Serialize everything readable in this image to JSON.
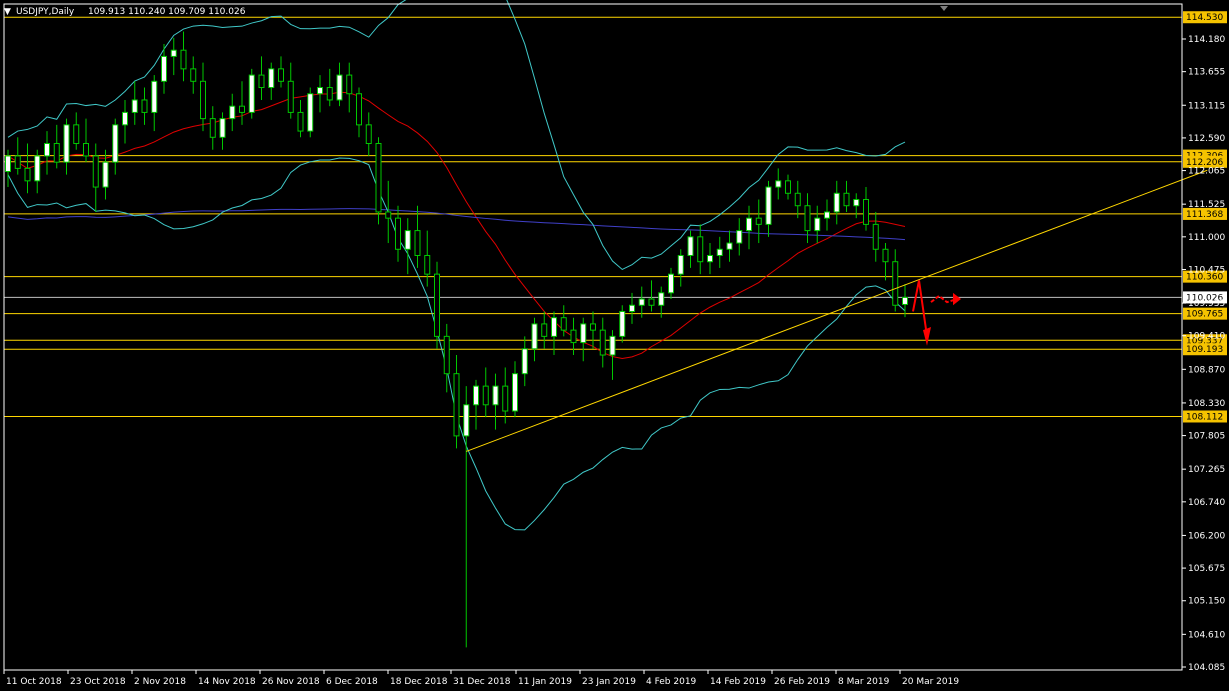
{
  "header": {
    "symbol": "USDJPY,Daily",
    "ohlc": "109.913 110.240 109.709 110.026"
  },
  "colors": {
    "background": "#000000",
    "axis": "#ffffff",
    "candle_up": "#ffffff",
    "candle_down": "#000000",
    "candle_wick": "#00c800",
    "ma_red": "#e00000",
    "ma_blue": "#4040c8",
    "bollinger": "#40c8c8",
    "level_lines": "#ffd700",
    "trendline": "#ffd700",
    "arrows": "#ff0000",
    "label_bg": "#f5c300"
  },
  "chart_data": {
    "type": "candlestick",
    "title": "USDJPY,Daily",
    "ylim": [
      104.085,
      114.75
    ],
    "y_ticks": [
      114.18,
      113.655,
      113.115,
      112.59,
      112.065,
      111.525,
      111.0,
      110.475,
      109.935,
      109.41,
      108.87,
      108.33,
      107.805,
      107.265,
      106.74,
      106.2,
      105.675,
      105.15,
      104.61,
      104.085
    ],
    "y_tick_labels": [
      "114.180",
      "113.655",
      "113.115",
      "112.590",
      "112.065",
      "111.525",
      "111.000",
      "110.475",
      "109.935",
      "109.410",
      "108.870",
      "108.330",
      "107.805",
      "107.265",
      "106.740",
      "106.200",
      "105.675",
      "105.150",
      "104.610",
      "104.085"
    ],
    "x_labels": [
      "11 Oct 2018",
      "23 Oct 2018",
      "2 Nov 2018",
      "14 Nov 2018",
      "26 Nov 2018",
      "6 Dec 2018",
      "18 Dec 2018",
      "31 Dec 2018",
      "11 Jan 2019",
      "23 Jan 2019",
      "4 Feb 2019",
      "14 Feb 2019",
      "26 Feb 2019",
      "8 Mar 2019",
      "20 Mar 2019"
    ],
    "horizontal_levels": [
      {
        "value": 114.53,
        "label": "114.530"
      },
      {
        "value": 112.306,
        "label": "112.306"
      },
      {
        "value": 112.206,
        "label": "112.206"
      },
      {
        "value": 111.368,
        "label": "111.368"
      },
      {
        "value": 110.36,
        "label": "110.360"
      },
      {
        "value": 110.026,
        "label": "110.026",
        "current": true
      },
      {
        "value": 109.765,
        "label": "109.765"
      },
      {
        "value": 109.337,
        "label": "109.337"
      },
      {
        "value": 109.193,
        "label": "109.193"
      },
      {
        "value": 108.112,
        "label": "108.112"
      }
    ],
    "candles": [
      [
        112.05,
        112.4,
        111.8,
        112.3
      ],
      [
        112.3,
        112.6,
        112.0,
        112.1
      ],
      [
        112.1,
        112.5,
        111.7,
        111.9
      ],
      [
        111.9,
        112.4,
        111.7,
        112.3
      ],
      [
        112.3,
        112.7,
        112.0,
        112.5
      ],
      [
        112.5,
        112.8,
        112.1,
        112.2
      ],
      [
        112.2,
        112.9,
        112.0,
        112.8
      ],
      [
        112.8,
        113.0,
        112.4,
        112.5
      ],
      [
        112.5,
        112.9,
        112.2,
        112.3
      ],
      [
        112.3,
        112.5,
        111.4,
        111.8
      ],
      [
        111.8,
        112.4,
        111.6,
        112.2
      ],
      [
        112.2,
        112.9,
        112.0,
        112.8
      ],
      [
        112.8,
        113.2,
        112.5,
        113.0
      ],
      [
        113.0,
        113.5,
        112.8,
        113.2
      ],
      [
        113.2,
        113.4,
        112.8,
        113.0
      ],
      [
        113.0,
        113.6,
        112.7,
        113.5
      ],
      [
        113.5,
        114.1,
        113.3,
        113.9
      ],
      [
        113.9,
        114.2,
        113.6,
        114.0
      ],
      [
        114.0,
        114.3,
        113.5,
        113.7
      ],
      [
        113.7,
        113.9,
        113.3,
        113.5
      ],
      [
        113.5,
        113.8,
        112.7,
        112.9
      ],
      [
        112.9,
        113.1,
        112.4,
        112.6
      ],
      [
        112.6,
        113.0,
        112.4,
        112.9
      ],
      [
        112.9,
        113.3,
        112.7,
        113.1
      ],
      [
        113.1,
        113.5,
        112.8,
        113.0
      ],
      [
        113.0,
        113.7,
        112.9,
        113.6
      ],
      [
        113.6,
        113.9,
        113.2,
        113.4
      ],
      [
        113.4,
        113.8,
        113.2,
        113.7
      ],
      [
        113.7,
        113.9,
        113.4,
        113.5
      ],
      [
        113.5,
        113.8,
        112.9,
        113.0
      ],
      [
        113.0,
        113.2,
        112.6,
        112.7
      ],
      [
        112.7,
        113.4,
        112.6,
        113.3
      ],
      [
        113.3,
        113.6,
        113.0,
        113.4
      ],
      [
        113.4,
        113.7,
        113.1,
        113.2
      ],
      [
        113.2,
        113.8,
        113.1,
        113.6
      ],
      [
        113.6,
        113.8,
        113.0,
        113.3
      ],
      [
        113.3,
        113.4,
        112.6,
        112.8
      ],
      [
        112.8,
        113.0,
        112.3,
        112.5
      ],
      [
        112.5,
        112.6,
        111.2,
        111.4
      ],
      [
        111.4,
        111.9,
        110.9,
        111.3
      ],
      [
        111.3,
        111.5,
        110.6,
        110.8
      ],
      [
        110.8,
        111.3,
        110.4,
        111.1
      ],
      [
        111.1,
        111.5,
        110.5,
        110.7
      ],
      [
        110.7,
        111.1,
        110.2,
        110.4
      ],
      [
        110.4,
        110.6,
        109.2,
        109.4
      ],
      [
        109.4,
        109.6,
        108.5,
        108.8
      ],
      [
        108.8,
        109.1,
        107.6,
        107.8
      ],
      [
        107.8,
        108.6,
        104.4,
        108.3
      ],
      [
        108.3,
        108.7,
        107.9,
        108.6
      ],
      [
        108.6,
        108.9,
        108.1,
        108.3
      ],
      [
        108.3,
        108.8,
        107.9,
        108.6
      ],
      [
        108.6,
        108.9,
        108.0,
        108.2
      ],
      [
        108.2,
        109.0,
        108.1,
        108.8
      ],
      [
        108.8,
        109.4,
        108.6,
        109.2
      ],
      [
        109.2,
        109.7,
        109.0,
        109.6
      ],
      [
        109.6,
        109.8,
        109.2,
        109.4
      ],
      [
        109.4,
        109.8,
        109.1,
        109.7
      ],
      [
        109.7,
        109.9,
        109.4,
        109.5
      ],
      [
        109.5,
        109.7,
        109.1,
        109.3
      ],
      [
        109.3,
        109.7,
        109.0,
        109.6
      ],
      [
        109.6,
        109.8,
        109.2,
        109.5
      ],
      [
        109.5,
        109.7,
        108.9,
        109.1
      ],
      [
        109.1,
        109.5,
        108.7,
        109.4
      ],
      [
        109.4,
        109.9,
        109.3,
        109.8
      ],
      [
        109.8,
        110.1,
        109.6,
        109.9
      ],
      [
        109.9,
        110.2,
        109.7,
        110.0
      ],
      [
        110.0,
        110.3,
        109.8,
        109.9
      ],
      [
        109.9,
        110.2,
        109.7,
        110.1
      ],
      [
        110.1,
        110.5,
        110.0,
        110.4
      ],
      [
        110.4,
        110.8,
        110.2,
        110.7
      ],
      [
        110.7,
        111.1,
        110.5,
        111.0
      ],
      [
        111.0,
        111.2,
        110.4,
        110.6
      ],
      [
        110.6,
        110.9,
        110.4,
        110.7
      ],
      [
        110.7,
        111.0,
        110.5,
        110.8
      ],
      [
        110.8,
        111.1,
        110.6,
        110.9
      ],
      [
        110.9,
        111.3,
        110.7,
        111.1
      ],
      [
        111.1,
        111.5,
        110.8,
        111.3
      ],
      [
        111.3,
        111.6,
        110.9,
        111.2
      ],
      [
        111.2,
        111.9,
        111.0,
        111.8
      ],
      [
        111.8,
        112.1,
        111.6,
        111.9
      ],
      [
        111.9,
        112.0,
        111.6,
        111.7
      ],
      [
        111.7,
        111.9,
        111.3,
        111.5
      ],
      [
        111.5,
        111.7,
        110.9,
        111.1
      ],
      [
        111.1,
        111.5,
        110.9,
        111.3
      ],
      [
        111.3,
        111.6,
        111.1,
        111.4
      ],
      [
        111.4,
        111.9,
        111.2,
        111.7
      ],
      [
        111.7,
        111.9,
        111.4,
        111.5
      ],
      [
        111.5,
        111.7,
        111.3,
        111.6
      ],
      [
        111.6,
        111.8,
        111.1,
        111.2
      ],
      [
        111.2,
        111.4,
        110.6,
        110.8
      ],
      [
        110.8,
        110.9,
        110.3,
        110.6
      ],
      [
        110.6,
        110.8,
        109.8,
        109.9
      ],
      [
        109.913,
        110.24,
        109.709,
        110.026
      ]
    ],
    "trendline": {
      "from": [
        47,
        107.55
      ],
      "to": [
        123,
        112.07
      ]
    },
    "forecast_arrows": {
      "path_up_down": true,
      "sideways": true
    }
  }
}
